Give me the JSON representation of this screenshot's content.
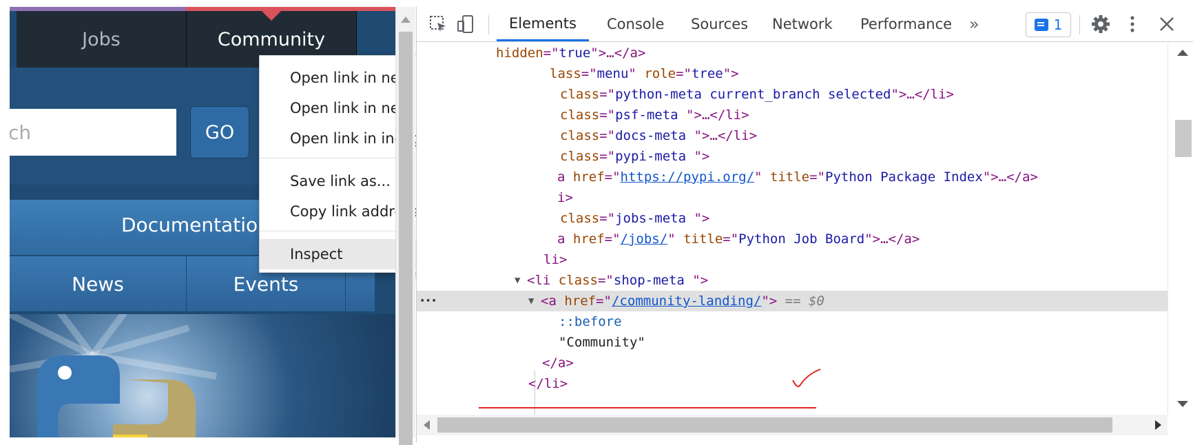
{
  "page": {
    "tabs": [
      "Jobs",
      "Community"
    ],
    "search_placeholder_fragment": "ch",
    "go_label": "GO",
    "documentation_label": "Documentation",
    "nav_items": [
      "News",
      "Events"
    ]
  },
  "context_menu": {
    "items": [
      "Open link in new tab",
      "Open link in new window",
      "Open link in incognito window",
      "Save link as...",
      "Copy link address",
      "Inspect"
    ],
    "highlighted": "Inspect"
  },
  "devtools": {
    "tabs": [
      "Elements",
      "Console",
      "Sources",
      "Network",
      "Performance"
    ],
    "active_tab": "Elements",
    "more_tabs_icon": "»",
    "issues_count": "1",
    "icons": [
      "inspect-element-icon",
      "device-toolbar-icon",
      "issues-icon",
      "gear-icon",
      "kebab-menu-icon",
      "close-icon"
    ],
    "code_lines": {
      "l1": {
        "attr": "hidden",
        "val": "true",
        "rest": ">…</a>"
      },
      "l2": {
        "attr": "lass",
        "val": "menu",
        "attr2": "role",
        "val2": "tree"
      },
      "l3": {
        "attr": "class",
        "val": "python-meta current_branch selected",
        "rest": "…</li>"
      },
      "l4": {
        "attr": "class",
        "val": "psf-meta ",
        "rest": "…</li>"
      },
      "l5": {
        "attr": "class",
        "val": "docs-meta ",
        "rest": "…</li>"
      },
      "l6": {
        "attr": "class",
        "val": "pypi-meta "
      },
      "l7": {
        "attr": "href",
        "val": "https://pypi.org/",
        "attr2": "title",
        "val2": "Python Package Index",
        "rest": "…</a>"
      },
      "l8": {
        "text": "i>"
      },
      "l9": {
        "attr": "class",
        "val": "jobs-meta "
      },
      "l10": {
        "attr": "href",
        "val": "/jobs/",
        "attr2": "title",
        "val2": "Python Job Board",
        "rest": "…</a>"
      },
      "l11": {
        "text": "li>"
      },
      "l12": {
        "tag": "<li",
        "attr": "class",
        "val": "shop-meta "
      },
      "l13": {
        "tag": "<a",
        "attr": "href",
        "val": "/community-landing/",
        "marker": "== $0"
      },
      "l14": {
        "text": "::before"
      },
      "l15": {
        "text": "\"Community\""
      },
      "l16": {
        "text": "</a>"
      },
      "l17": {
        "text": "</li>"
      }
    },
    "gutter_dots": "•••"
  },
  "colors": {
    "accent": "#1a73e8",
    "annotation": "#e0261d"
  }
}
